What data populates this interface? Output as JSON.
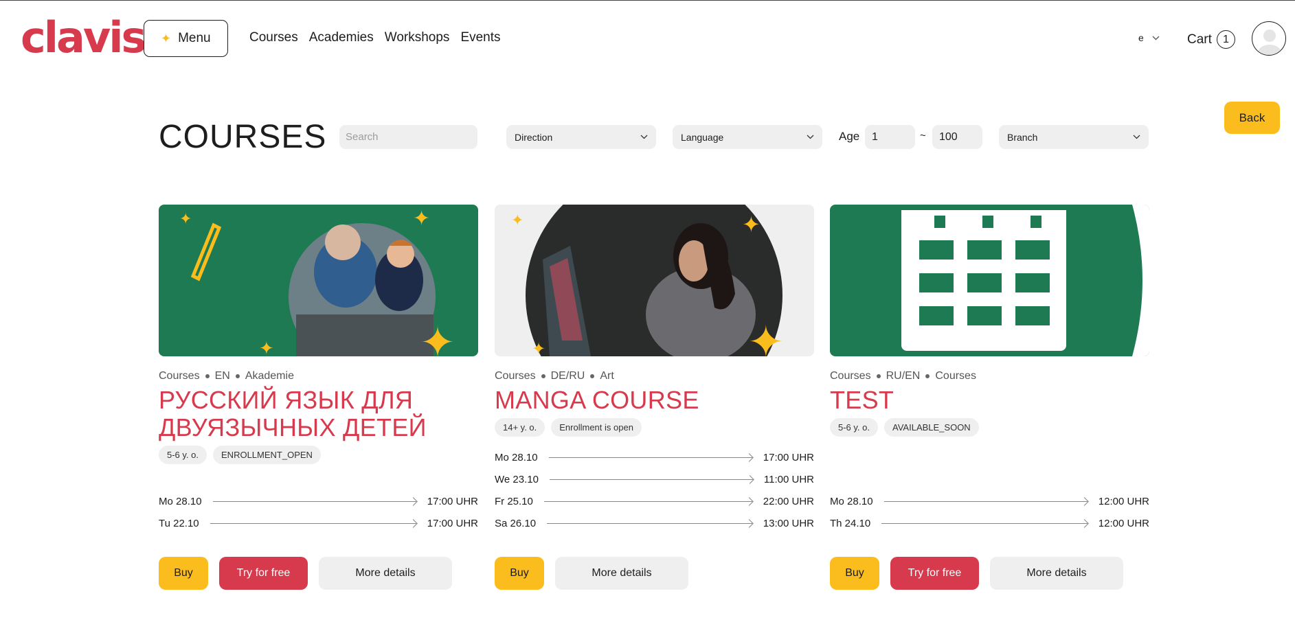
{
  "header": {
    "logo": "clavis",
    "menu_label": "Menu",
    "nav": [
      "Courses",
      "Academies",
      "Workshops",
      "Events"
    ],
    "language_label": "e",
    "cart_label": "Cart",
    "cart_count": "1"
  },
  "back_label": "Back",
  "filters": {
    "title": "COURSES",
    "search_placeholder": "Search",
    "direction": "Direction",
    "language": "Language",
    "age_label": "Age",
    "age_min": "1",
    "age_tilde": "~",
    "age_max": "100",
    "branch": "Branch"
  },
  "colors": {
    "brand_red": "#d63a4c",
    "accent_yellow": "#fbbd1e",
    "card_green": "#1e7a52",
    "chip_grey": "#efefef"
  },
  "courses": [
    {
      "meta": [
        "Courses",
        "EN",
        "Akademie"
      ],
      "title": "РУССКИЙ ЯЗЫК ДЛЯ ДВУЯЗЫЧНЫХ ДЕТЕЙ",
      "tags": [
        "5-6 y. o.",
        "ENROLLMENT_OPEN"
      ],
      "sessions": [
        {
          "day": "Mo 28.10",
          "time": "17:00 UHR"
        },
        {
          "day": "Tu 22.10",
          "time": "17:00 UHR"
        }
      ],
      "buttons": {
        "buy": "Buy",
        "try": "Try for free",
        "more": "More details"
      }
    },
    {
      "meta": [
        "Courses",
        "DE/RU",
        "Art"
      ],
      "title": "MANGA COURSE",
      "tags": [
        "14+ y. o.",
        "Enrollment is open"
      ],
      "sessions": [
        {
          "day": "Mo 28.10",
          "time": "17:00 UHR"
        },
        {
          "day": "We 23.10",
          "time": "11:00 UHR"
        },
        {
          "day": "Fr 25.10",
          "time": "22:00 UHR"
        },
        {
          "day": "Sa 26.10",
          "time": "13:00 UHR"
        }
      ],
      "buttons": {
        "buy": "Buy",
        "more": "More details"
      }
    },
    {
      "meta": [
        "Courses",
        "RU/EN",
        "Courses"
      ],
      "title": "TEST",
      "tags": [
        "5-6 y. o.",
        "AVAILABLE_SOON"
      ],
      "sessions": [
        {
          "day": "Mo 28.10",
          "time": "12:00 UHR"
        },
        {
          "day": "Th 24.10",
          "time": "12:00 UHR"
        }
      ],
      "buttons": {
        "buy": "Buy",
        "try": "Try for free",
        "more": "More details"
      }
    }
  ]
}
